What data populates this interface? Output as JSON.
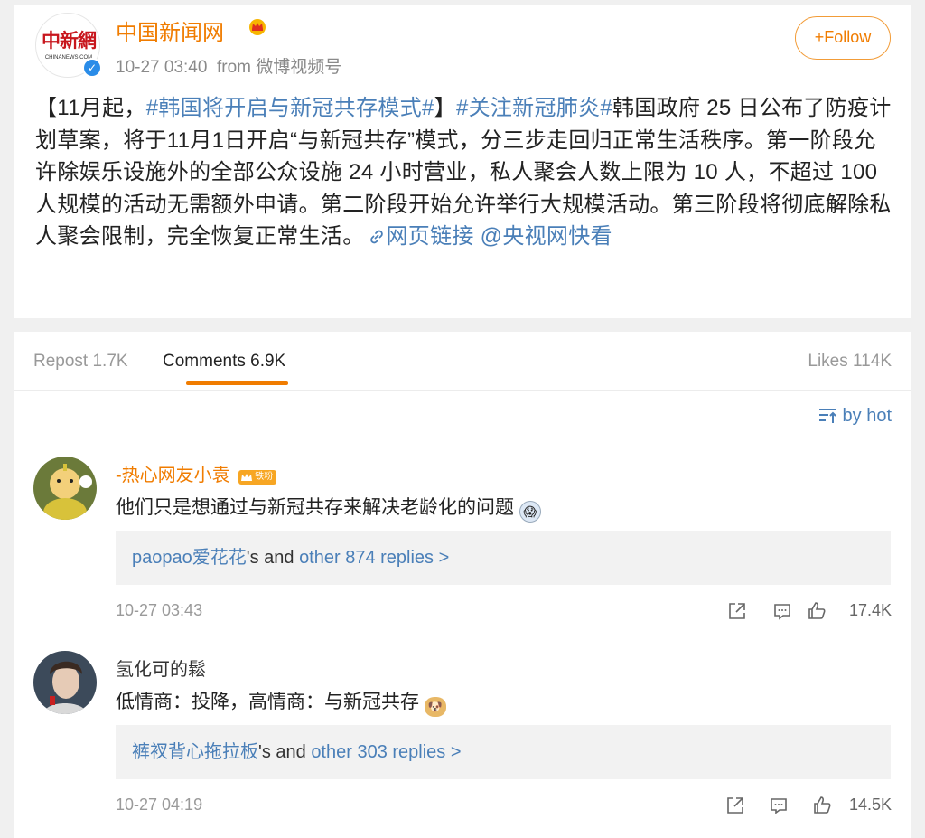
{
  "post": {
    "logo_text": "中新網",
    "logo_sub": "CHINANEWS.COM",
    "username": "中国新闻网",
    "time": "10-27 03:40",
    "from_label": "from",
    "source": "微博视频号",
    "follow_label": "+Follow",
    "body": {
      "p1": "【11月起，",
      "tag1": "#韩国将开启与新冠共存模式#",
      "p2": "】",
      "tag2": "#关注新冠肺炎#",
      "p3": "韩国政府 25 日公布了防疫计划草案，将于11月1日开启“与新冠共存”模式，分三步走回归正常生活秩序。第一阶段允许除娱乐设施外的全部公众设施 24 小时营业，私人聚会人数上限为 10 人，不超过 100 人规模的活动无需额外申请。第二阶段开始允许举行大规模活动。第三阶段将彻底解除私人聚会限制，完全恢复正常生活。",
      "link1": "网页链接",
      "link2": "@央视网快看"
    }
  },
  "tabs": {
    "repost": "Repost 1.7K",
    "comments": "Comments 6.9K",
    "likes": "Likes 114K"
  },
  "sort_label": "by hot",
  "comments": [
    {
      "name": "-热心网友小袁",
      "fan_badge": "铁粉",
      "text": "他们只是想通过与新冠共存来解决老龄化的问题",
      "reply_user": "paopao爱花花",
      "reply_mid": "'s and",
      "reply_more": "other 874 replies >",
      "time": "10-27 03:43",
      "likes": "17.4K"
    },
    {
      "name": "氢化可的鬆",
      "text": "低情商：投降，高情商：与新冠共存",
      "reply_user": "裤衩背心拖拉板",
      "reply_mid": "'s and",
      "reply_more": "other 303 replies >",
      "time": "10-27 04:19",
      "likes": "14.5K"
    }
  ],
  "colors": {
    "accent": "#f07c00",
    "link": "#4a7fb8",
    "verified": "#2a8ce8"
  }
}
